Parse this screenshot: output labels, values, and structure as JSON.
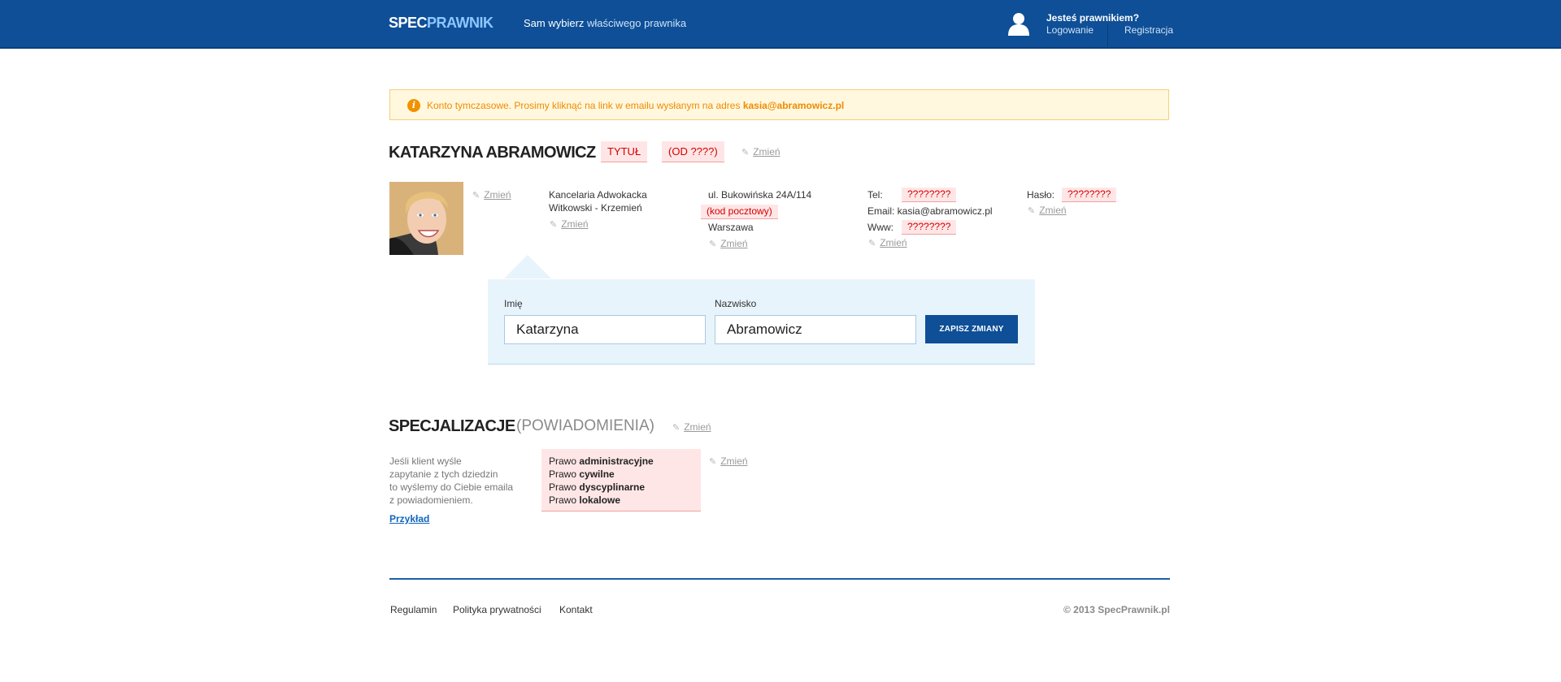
{
  "header": {
    "logo_part1": "SPEC",
    "logo_part2": "PRAWNIK",
    "tagline_bold": "Sam wybierz",
    "tagline_rest": " właściwego prawnika",
    "lawyer_question": "Jesteś prawnikiem?",
    "login_label": "Logowanie",
    "register_label": "Registracja"
  },
  "alert": {
    "icon": "info-icon",
    "message": "Konto tymczasowe. Prosimy kliknąć na link w emailu wysłanym na adres ",
    "email": "kasia@abramowicz.pl"
  },
  "profile": {
    "name": "KATARZYNA ABRAMOWICZ",
    "title_tag": "TYTUŁ",
    "since_tag": "(OD ????)",
    "edit_label": "Zmień",
    "office_line1": "Kancelaria Adwokacka",
    "office_line2": "Witkowski - Krzemień",
    "street": "ul. Bukowińska 24A/114",
    "postal_code": "(kod pocztowy)",
    "city": "Warszawa",
    "tel_label": "Tel:",
    "tel_value": "????????",
    "email_line": "Email: kasia@abramowicz.pl",
    "www_label": "Www:",
    "www_value": "????????",
    "password_label": "Hasło:",
    "password_value": "????????"
  },
  "form": {
    "first_name_label": "Imię",
    "first_name_value": "Katarzyna",
    "last_name_label": "Nazwisko",
    "last_name_value": "Abramowicz",
    "save_label": "ZAPISZ ZMIANY"
  },
  "specializations": {
    "title": "SPECJALIZACJE",
    "subtitle": "(POWIADOMIENIA)",
    "edit_label": "Zmień",
    "description": [
      "Jeśli klient wyśle",
      "zapytanie z tych dziedzin",
      "to wyślemy do Ciebie emaila",
      "z powiadomieniem."
    ],
    "example_link": "Przykład",
    "prefix": "Prawo",
    "items": [
      "administracyjne",
      "cywilne",
      "dyscyplinarne",
      "lokalowe"
    ]
  },
  "footer": {
    "links": [
      "Regulamin",
      "Polityka prywatności",
      "Kontakt"
    ],
    "copyright": "© 2013 SpecPrawnik.pl"
  },
  "colors": {
    "brand_blue": "#0e4f97",
    "warning_orange": "#f08a00",
    "missing_red": "#d40000"
  }
}
